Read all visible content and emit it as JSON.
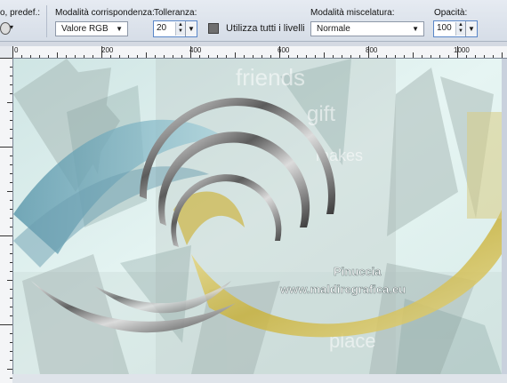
{
  "toolbar": {
    "presets_label": "o, predef.:",
    "match_mode_label": "Modalità corrispondenza:",
    "match_mode_value": "Valore RGB",
    "tolerance_label": "Tolleranza:",
    "tolerance_value": "20",
    "use_all_layers_label": "Utilizza tutti i livelli",
    "blend_mode_label": "Modalità miscelatura:",
    "blend_mode_value": "Normale",
    "opacity_label": "Opacità:",
    "opacity_value": "100"
  },
  "rulers": {
    "top_ticks": [
      "0",
      "200",
      "400",
      "600",
      "800",
      "1000"
    ]
  },
  "artwork": {
    "watermark_line1": "Pinuccia",
    "watermark_line2": "www.maldiregrafica.eu",
    "word_friends": "friends",
    "word_gift": "gift",
    "word_makes": "makes",
    "word_place": "place"
  }
}
